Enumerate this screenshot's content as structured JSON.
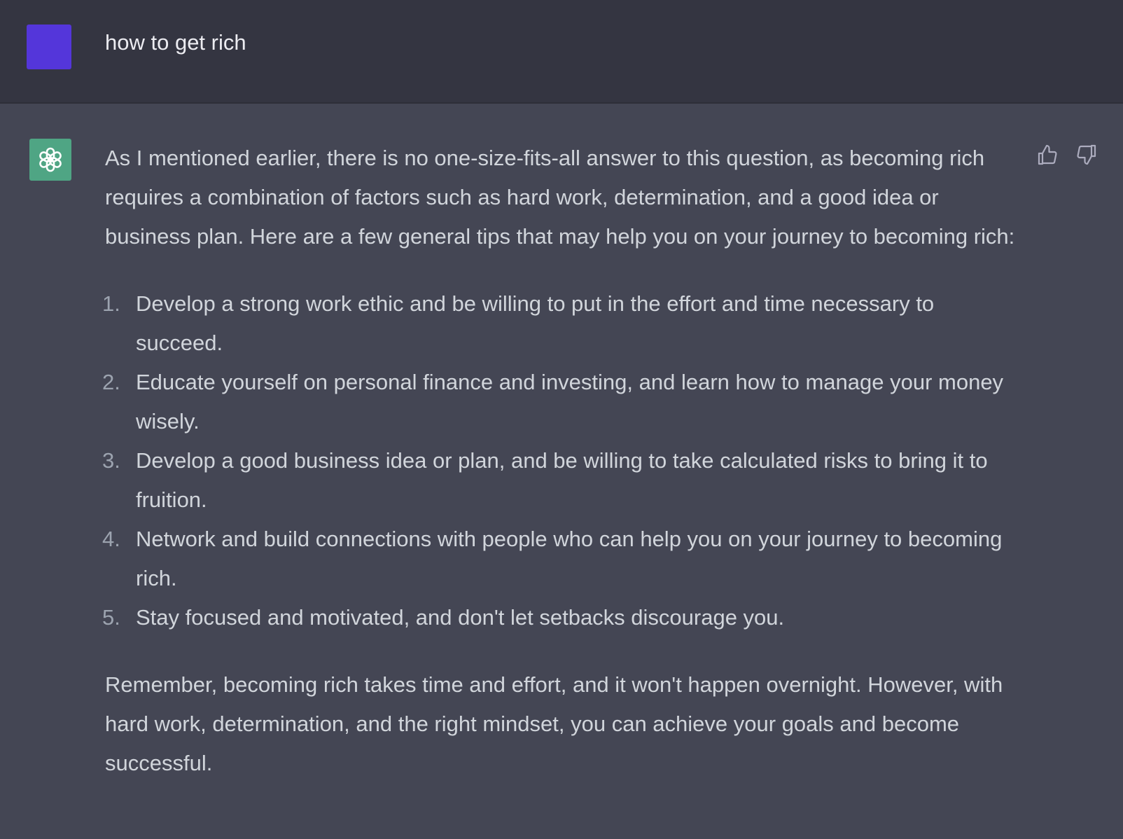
{
  "user": {
    "message": "how to get rich"
  },
  "assistant": {
    "intro": "As I mentioned earlier, there is no one-size-fits-all answer to this question, as becoming rich requires a combination of factors such as hard work, determination, and a good idea or business plan. Here are a few general tips that may help you on your journey to becoming rich:",
    "tips": [
      {
        "num": "1.",
        "text": "Develop a strong work ethic and be willing to put in the effort and time necessary to succeed."
      },
      {
        "num": "2.",
        "text": "Educate yourself on personal finance and investing, and learn how to manage your money wisely."
      },
      {
        "num": "3.",
        "text": "Develop a good business idea or plan, and be willing to take calculated risks to bring it to fruition."
      },
      {
        "num": "4.",
        "text": "Network and build connections with people who can help you on your journey to becoming rich."
      },
      {
        "num": "5.",
        "text": "Stay focused and motivated, and don't let setbacks discourage you."
      }
    ],
    "outro": "Remember, becoming rich takes time and effort, and it won't happen overnight. However, with hard work, determination, and the right mindset, you can achieve your goals and become successful."
  },
  "icons": {
    "assistant_avatar": "openai-logo-icon",
    "thumbs_up": "thumbs-up-icon",
    "thumbs_down": "thumbs-down-icon"
  },
  "colors": {
    "user_row_bg": "#343541",
    "assistant_row_bg": "#444654",
    "user_avatar": "#5436da",
    "assistant_avatar": "#4fa584",
    "text": "#d1d5db"
  }
}
